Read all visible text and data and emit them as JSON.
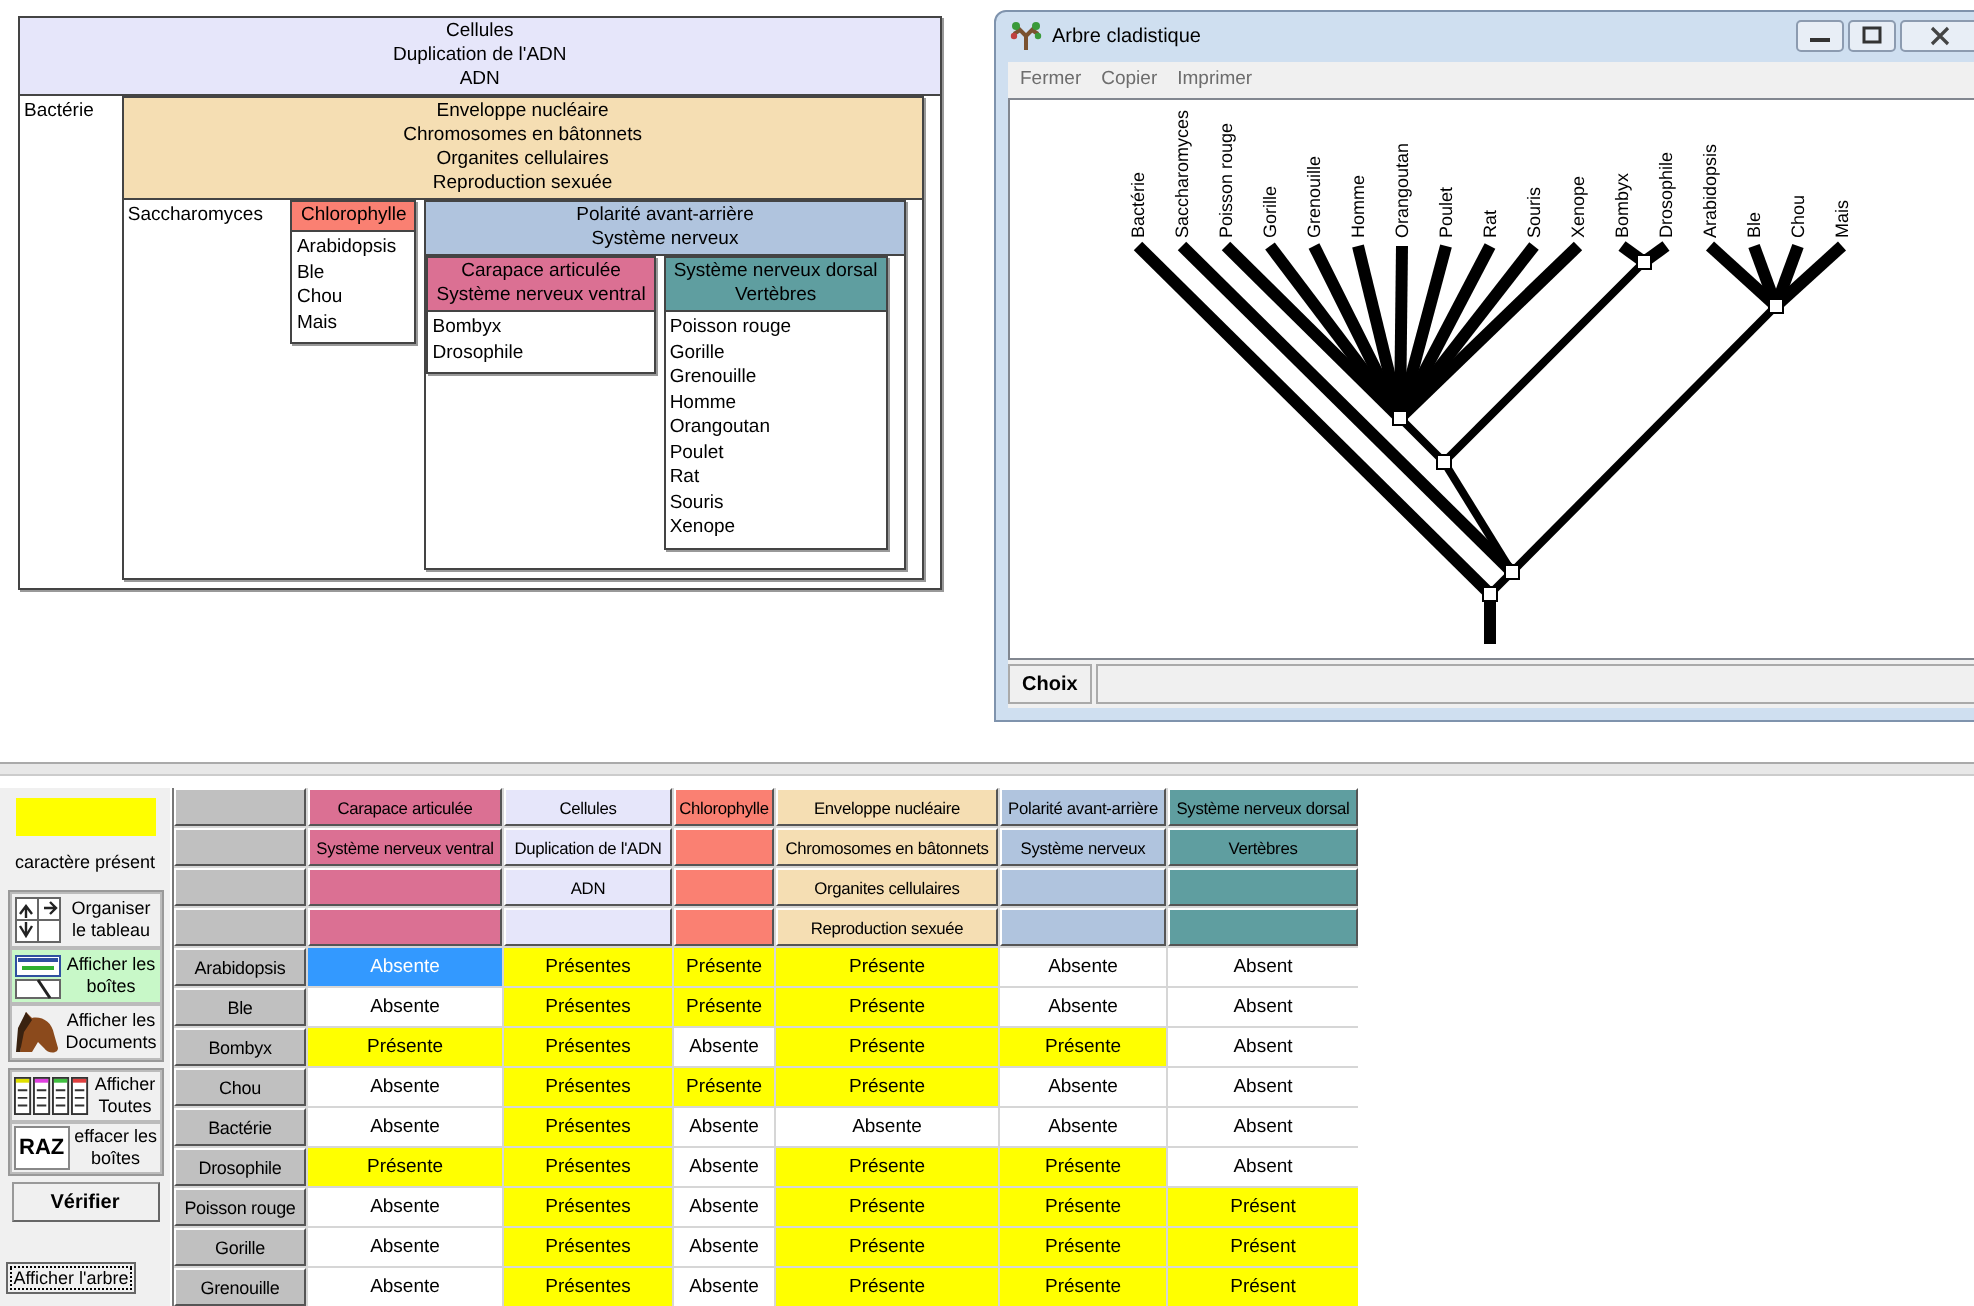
{
  "diagram": {
    "box": {
      "characters": [
        "Cellules",
        "Duplication de l'ADN",
        "ADN"
      ],
      "color": "#e6e6fa",
      "taxa": [
        "Bactérie"
      ],
      "boxes": [
        {
          "characters": [
            "Enveloppe nucléaire",
            "Chromosomes en bâtonnets",
            "Organites cellulaires",
            "Reproduction sexuée"
          ],
          "color": "#f5deb3",
          "taxa": [
            "Saccharomyces"
          ],
          "boxes": [
            {
              "characters": [
                "Chlorophylle"
              ],
              "color": "#fa8072",
              "taxa": [
                "Arabidopsis",
                "Ble",
                "Chou",
                "Mais"
              ]
            },
            {
              "characters": [
                "Polarité avant-arrière",
                "Système nerveux"
              ],
              "color": "#b0c4de",
              "boxes": [
                {
                  "characters": [
                    "Carapace articulée",
                    "Système nerveux ventral"
                  ],
                  "color": "#db7093",
                  "taxa": [
                    "Bombyx",
                    "Drosophile"
                  ]
                },
                {
                  "characters": [
                    "Système nerveux dorsal",
                    "Vertèbres"
                  ],
                  "color": "#5f9ea0",
                  "taxa": [
                    "Poisson rouge",
                    "Gorille",
                    "Grenouille",
                    "Homme",
                    "Orangoutan",
                    "Poulet",
                    "Rat",
                    "Souris",
                    "Xenope"
                  ]
                }
              ]
            }
          ]
        }
      ]
    }
  },
  "tree_window": {
    "title": "Arbre cladistique",
    "menu": [
      {
        "label": "Fermer",
        "disabled": true
      },
      {
        "label": "Copier",
        "disabled": true
      },
      {
        "label": "Imprimer",
        "disabled": true
      }
    ],
    "leaves": [
      "Bactérie",
      "Saccharomyces",
      "Poisson rouge",
      "Gorille",
      "Grenouille",
      "Homme",
      "Orangoutan",
      "Poulet",
      "Rat",
      "Souris",
      "Xenope",
      "Bombyx",
      "Drosophile",
      "Arabidopsis",
      "Ble",
      "Chou",
      "Mais"
    ],
    "choice_button": "Choix"
  },
  "legend": {
    "label": "caractère présent"
  },
  "tool_groups": [
    {
      "tools": [
        {
          "kind": "organize",
          "label": "Organiser le tableau",
          "selected": false
        },
        {
          "kind": "boxes",
          "label": "Afficher les boîtes",
          "selected": true
        },
        {
          "kind": "documents",
          "label": "Afficher les Documents",
          "selected": false
        }
      ]
    },
    {
      "tools": [
        {
          "kind": "show_all",
          "label": "Afficher Toutes",
          "selected": false
        },
        {
          "kind": "reset",
          "label": "effacer les boîtes",
          "badge": "RAZ",
          "selected": false
        }
      ]
    }
  ],
  "verify_button": "Vérifier",
  "tree_button": "Afficher l'arbre",
  "table": {
    "columns": [
      {
        "characters": [
          "Carapace articulée",
          "Système nerveux ventral"
        ],
        "color": "#db7093"
      },
      {
        "characters": [
          "Cellules",
          "Duplication de l'ADN",
          "ADN"
        ],
        "color": "#e6e6fa"
      },
      {
        "characters": [
          "Chlorophylle"
        ],
        "color": "#fa8072"
      },
      {
        "characters": [
          "Enveloppe nucléaire",
          "Chromosomes en bâtonnets",
          "Organites cellulaires",
          "Reproduction sexuée"
        ],
        "color": "#f5deb3"
      },
      {
        "characters": [
          "Polarité avant-arrière",
          "Système nerveux"
        ],
        "color": "#b0c4de"
      },
      {
        "characters": [
          "Système nerveux dorsal",
          "Vertèbres"
        ],
        "color": "#5f9ea0"
      }
    ],
    "rows": [
      {
        "name": "Arabidopsis",
        "cells": [
          {
            "text": "Absente",
            "present": false,
            "selected": true
          },
          {
            "text": "Présentes",
            "present": true,
            "selected": false
          },
          {
            "text": "Présente",
            "present": true,
            "selected": false
          },
          {
            "text": "Présente",
            "present": true,
            "selected": false
          },
          {
            "text": "Absente",
            "present": false,
            "selected": false
          },
          {
            "text": "Absent",
            "present": false,
            "selected": false
          }
        ]
      },
      {
        "name": "Ble",
        "cells": [
          {
            "text": "Absente",
            "present": false,
            "selected": false
          },
          {
            "text": "Présentes",
            "present": true,
            "selected": false
          },
          {
            "text": "Présente",
            "present": true,
            "selected": false
          },
          {
            "text": "Présente",
            "present": true,
            "selected": false
          },
          {
            "text": "Absente",
            "present": false,
            "selected": false
          },
          {
            "text": "Absent",
            "present": false,
            "selected": false
          }
        ]
      },
      {
        "name": "Bombyx",
        "cells": [
          {
            "text": "Présente",
            "present": true,
            "selected": false
          },
          {
            "text": "Présentes",
            "present": true,
            "selected": false
          },
          {
            "text": "Absente",
            "present": false,
            "selected": false
          },
          {
            "text": "Présente",
            "present": true,
            "selected": false
          },
          {
            "text": "Présente",
            "present": true,
            "selected": false
          },
          {
            "text": "Absent",
            "present": false,
            "selected": false
          }
        ]
      },
      {
        "name": "Chou",
        "cells": [
          {
            "text": "Absente",
            "present": false,
            "selected": false
          },
          {
            "text": "Présentes",
            "present": true,
            "selected": false
          },
          {
            "text": "Présente",
            "present": true,
            "selected": false
          },
          {
            "text": "Présente",
            "present": true,
            "selected": false
          },
          {
            "text": "Absente",
            "present": false,
            "selected": false
          },
          {
            "text": "Absent",
            "present": false,
            "selected": false
          }
        ]
      },
      {
        "name": "Bactérie",
        "cells": [
          {
            "text": "Absente",
            "present": false,
            "selected": false
          },
          {
            "text": "Présentes",
            "present": true,
            "selected": false
          },
          {
            "text": "Absente",
            "present": false,
            "selected": false
          },
          {
            "text": "Absente",
            "present": false,
            "selected": false
          },
          {
            "text": "Absente",
            "present": false,
            "selected": false
          },
          {
            "text": "Absent",
            "present": false,
            "selected": false
          }
        ]
      },
      {
        "name": "Drosophile",
        "cells": [
          {
            "text": "Présente",
            "present": true,
            "selected": false
          },
          {
            "text": "Présentes",
            "present": true,
            "selected": false
          },
          {
            "text": "Absente",
            "present": false,
            "selected": false
          },
          {
            "text": "Présente",
            "present": true,
            "selected": false
          },
          {
            "text": "Présente",
            "present": true,
            "selected": false
          },
          {
            "text": "Absent",
            "present": false,
            "selected": false
          }
        ]
      },
      {
        "name": "Poisson rouge",
        "cells": [
          {
            "text": "Absente",
            "present": false,
            "selected": false
          },
          {
            "text": "Présentes",
            "present": true,
            "selected": false
          },
          {
            "text": "Absente",
            "present": false,
            "selected": false
          },
          {
            "text": "Présente",
            "present": true,
            "selected": false
          },
          {
            "text": "Présente",
            "present": true,
            "selected": false
          },
          {
            "text": "Présent",
            "present": true,
            "selected": false
          }
        ]
      },
      {
        "name": "Gorille",
        "cells": [
          {
            "text": "Absente",
            "present": false,
            "selected": false
          },
          {
            "text": "Présentes",
            "present": true,
            "selected": false
          },
          {
            "text": "Absente",
            "present": false,
            "selected": false
          },
          {
            "text": "Présente",
            "present": true,
            "selected": false
          },
          {
            "text": "Présente",
            "present": true,
            "selected": false
          },
          {
            "text": "Présent",
            "present": true,
            "selected": false
          }
        ]
      },
      {
        "name": "Grenouille",
        "cells": [
          {
            "text": "Absente",
            "present": false,
            "selected": false
          },
          {
            "text": "Présentes",
            "present": true,
            "selected": false
          },
          {
            "text": "Absente",
            "present": false,
            "selected": false
          },
          {
            "text": "Présente",
            "present": true,
            "selected": false
          },
          {
            "text": "Présente",
            "present": true,
            "selected": false
          },
          {
            "text": "Présent",
            "present": true,
            "selected": false
          }
        ]
      }
    ]
  }
}
